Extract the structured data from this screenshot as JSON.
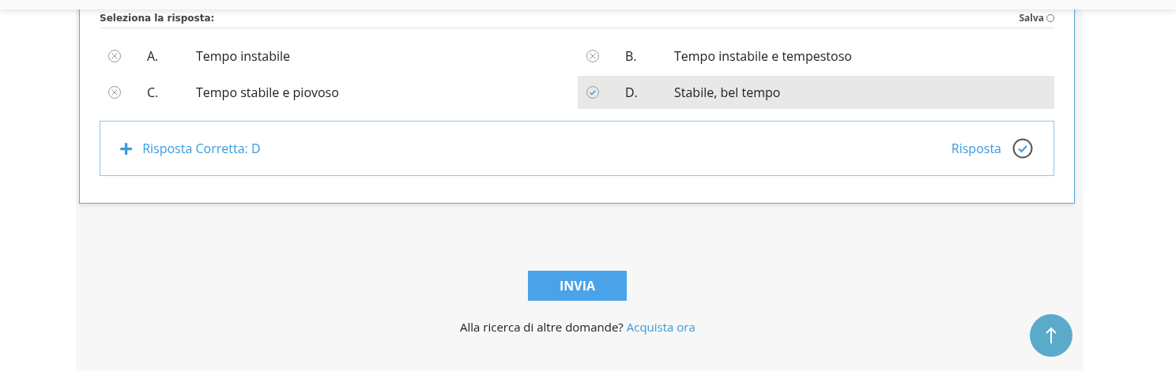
{
  "question_header": {
    "prompt": "Seleziona la risposta:",
    "save_label": "Salva",
    "saved": false
  },
  "options": [
    {
      "letter": "A.",
      "text": "Tempo instabile",
      "selected": false
    },
    {
      "letter": "B.",
      "text": "Tempo instabile e tempestoso",
      "selected": false
    },
    {
      "letter": "C.",
      "text": "Tempo stabile e piovoso",
      "selected": false
    },
    {
      "letter": "D.",
      "text": "Stabile, bel tempo",
      "selected": true
    }
  ],
  "answer_box": {
    "expand_icon": "+",
    "label": "Risposta Corretta: D",
    "right_label": "Risposta",
    "expanded": false
  },
  "submit_button": "INVIA",
  "footer": {
    "text": "Alla ricerca di altre domande?",
    "link": "Acquista ora"
  }
}
